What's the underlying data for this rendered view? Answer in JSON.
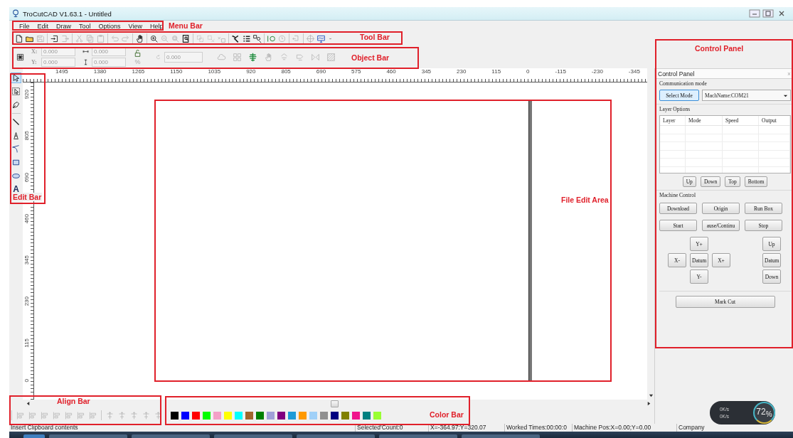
{
  "window": {
    "title": "TroCutCAD V1.63.1 - Untitled"
  },
  "menu_bar": [
    {
      "label": "File"
    },
    {
      "label": "Edit"
    },
    {
      "label": "Draw"
    },
    {
      "label": "Tool"
    },
    {
      "label": "Options"
    },
    {
      "label": "View"
    },
    {
      "label": "Help"
    }
  ],
  "tool_bar": {
    "groups": [
      [
        {
          "disabled": false
        },
        {
          "disabled": false
        },
        {
          "disabled": true
        }
      ],
      [
        {
          "disabled": false
        },
        {
          "disabled": true
        }
      ],
      [
        {
          "disabled": true
        },
        {
          "disabled": true
        },
        {
          "disabled": true
        }
      ],
      [
        {
          "disabled": true
        },
        {
          "disabled": true
        }
      ],
      [
        {
          "disabled": false
        }
      ],
      [
        {
          "disabled": false
        },
        {
          "disabled": true
        },
        {
          "disabled": true
        },
        {
          "disabled": false
        }
      ],
      [
        {
          "disabled": true
        },
        {
          "disabled": true
        },
        {
          "disabled": true
        }
      ],
      [
        {
          "disabled": false
        },
        {
          "disabled": false
        },
        {
          "disabled": false
        }
      ],
      [
        {
          "disabled": false
        },
        {
          "disabled": true
        }
      ],
      [
        {
          "disabled": true
        }
      ],
      [
        {
          "disabled": true
        },
        {
          "disabled": false
        }
      ]
    ]
  },
  "object_bar": {
    "fields": [
      {
        "kind": "x",
        "label": "X:",
        "value": "0.000",
        "disabled": true
      },
      {
        "kind": "y",
        "label": "Y:",
        "value": "0.000",
        "disabled": true
      },
      {
        "kind": "width",
        "value": "0.000",
        "disabled": true
      },
      {
        "kind": "height",
        "value": "0.000",
        "disabled": true
      },
      {
        "kind": "rotation",
        "value": "0.000",
        "disabled": true
      }
    ],
    "scale_unit": "%",
    "tools": [
      {
        "disabled": true
      },
      {
        "disabled": true
      },
      {
        "disabled": false
      },
      {
        "disabled": true
      },
      {
        "disabled": true
      },
      {
        "disabled": true
      },
      {
        "disabled": true
      },
      {
        "disabled": true
      }
    ]
  },
  "edit_bar": {
    "groups": [
      [
        {
          "selected": true
        },
        {
          "selected": false
        },
        {
          "selected": false
        }
      ],
      [
        {
          "selected": false
        },
        {
          "selected": false
        },
        {
          "selected": false
        },
        {
          "selected": false
        },
        {
          "selected": false
        },
        {
          "label": "A",
          "selected": false
        }
      ]
    ]
  },
  "rulers": {
    "horizontal": [
      "1495",
      "1380",
      "1265",
      "1150",
      "1035",
      "920",
      "805",
      "690",
      "575",
      "460",
      "345",
      "230",
      "115",
      "0",
      "-115",
      "-230",
      "-345"
    ],
    "vertical": [
      "920",
      "805",
      "690",
      "460",
      "345",
      "230",
      "115",
      "0"
    ]
  },
  "align_bar": {
    "groups": [
      [
        {
          "disabled": true
        },
        {
          "disabled": true
        },
        {
          "disabled": true
        },
        {
          "disabled": true
        },
        {
          "disabled": true
        },
        {
          "disabled": true
        },
        {
          "disabled": true
        }
      ],
      [
        {
          "disabled": true
        },
        {
          "disabled": true
        },
        {
          "disabled": true
        },
        {
          "disabled": true
        },
        {
          "disabled": true
        }
      ]
    ]
  },
  "color_bar": [
    {
      "color": "#000000"
    },
    {
      "color": "#0000ff"
    },
    {
      "color": "#ff0000"
    },
    {
      "color": "#00ff00"
    },
    {
      "color": "#f4a0c8"
    },
    {
      "color": "#ffff00"
    },
    {
      "color": "#00ffff"
    },
    {
      "color": "#a0642d"
    },
    {
      "color": "#008000"
    },
    {
      "color": "#a0a0d8"
    },
    {
      "color": "#800080"
    },
    {
      "color": "#1e9bd7"
    },
    {
      "color": "#ff9900"
    },
    {
      "color": "#a0d0f8"
    },
    {
      "color": "#909090"
    },
    {
      "color": "#000080"
    },
    {
      "color": "#808000"
    },
    {
      "color": "#f0148c"
    },
    {
      "color": "#008080"
    },
    {
      "color": "#99ff33"
    }
  ],
  "control_panel": {
    "title": "Control Panel",
    "close": "×",
    "communication": {
      "heading": "Communication mode",
      "mode_button": {
        "label": "Select Mode",
        "focused": true
      },
      "machine": "MachName:COM21"
    },
    "layers": {
      "heading": "Layer Options",
      "columns": [
        "Layer",
        "Mode",
        "Speed",
        "Output"
      ],
      "buttons": [
        "Up",
        "Down",
        "Top",
        "Bottom"
      ]
    },
    "machine": {
      "heading": "Machine Control",
      "buttons": [
        "Download",
        "Origin",
        "Run Box",
        "Start",
        "ause/Continu",
        "Stop"
      ],
      "jog_xy": {
        "y_plus": "Y+",
        "x_minus": "X-",
        "datum": "Datum",
        "x_plus": "X+",
        "y_minus": "Y-"
      },
      "jog_z": [
        "Up",
        "Datum",
        "Down"
      ],
      "mark_cut": "Mark Cut"
    }
  },
  "status_bar": [
    "Insert Clipboard contents",
    "Selected'Count:0",
    "X=-364.97:Y=320.07",
    "Worked Times:00:00:0",
    "Machine Pos:X=0.00;Y=0.00",
    "Company"
  ],
  "network_widget": {
    "upload": "0K/s",
    "download": "0K/s",
    "usage": "72$_{%}$"
  },
  "annotations": [
    {
      "label": "Menu Bar"
    },
    {
      "label": "Tool Bar"
    },
    {
      "label": "Object Bar"
    },
    {
      "label": "Control Panel"
    },
    {
      "label": "Edit Bar"
    },
    {
      "label": "File Edit Area"
    },
    {
      "label": "Align Bar"
    },
    {
      "label": "Color Bar"
    }
  ]
}
